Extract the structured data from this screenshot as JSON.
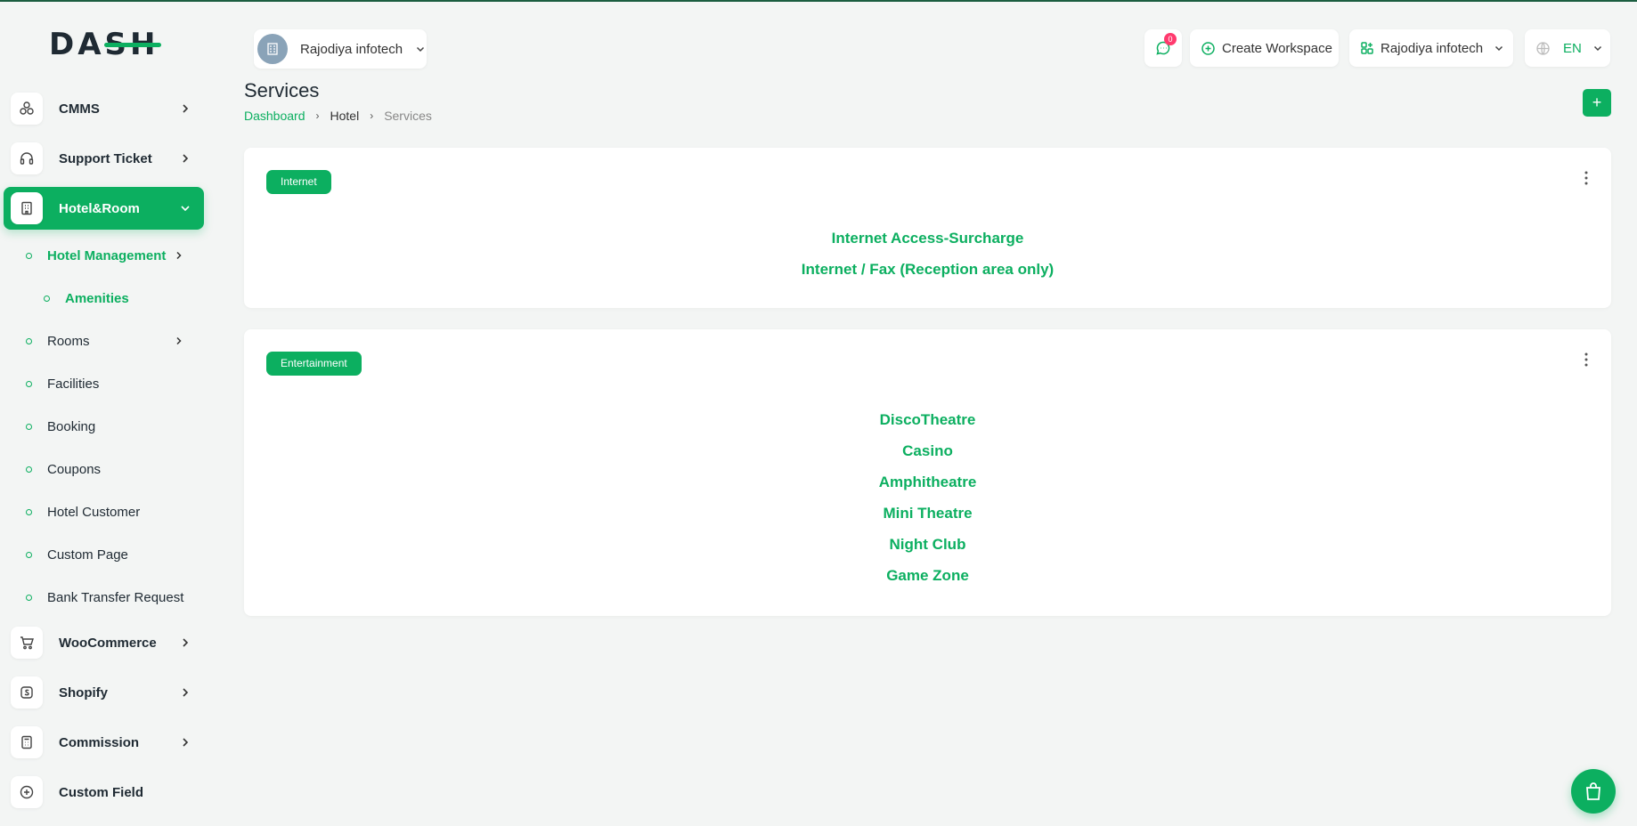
{
  "brand": {
    "logo_text": "DASH"
  },
  "sidebar": {
    "items": [
      {
        "label": "CMMS",
        "icon": "cmms-icon"
      },
      {
        "label": "Support Ticket",
        "icon": "headset-icon"
      },
      {
        "label": "Hotel&Room",
        "icon": "building-icon"
      },
      {
        "label": "WooCommerce",
        "icon": "cart-icon"
      },
      {
        "label": "Shopify",
        "icon": "shopify-icon"
      },
      {
        "label": "Commission",
        "icon": "calculator-icon"
      },
      {
        "label": "Custom Field",
        "icon": "plus-circle-icon"
      }
    ],
    "sub_items": [
      {
        "label": "Hotel Management"
      },
      {
        "label": "Amenities"
      },
      {
        "label": "Rooms"
      },
      {
        "label": "Facilities"
      },
      {
        "label": "Booking"
      },
      {
        "label": "Coupons"
      },
      {
        "label": "Hotel Customer"
      },
      {
        "label": "Custom Page"
      },
      {
        "label": "Bank Transfer Request"
      }
    ]
  },
  "header": {
    "workspace_name": "Rajodiya infotech",
    "notification_count": "0",
    "create_workspace_label": "Create Workspace",
    "user_workspace_label": "Rajodiya infotech",
    "language": "EN"
  },
  "page": {
    "title": "Services",
    "breadcrumb": [
      "Dashboard",
      "Hotel",
      "Services"
    ],
    "add_button": "+"
  },
  "cards": [
    {
      "tag": "Internet",
      "services": [
        "Internet Access-Surcharge",
        "Internet / Fax (Reception area only)"
      ]
    },
    {
      "tag": "Entertainment",
      "services": [
        "DiscoTheatre",
        "Casino",
        "Amphitheatre",
        "Mini Theatre",
        "Night Club",
        "Game Zone"
      ]
    }
  ],
  "colors": {
    "accent": "#0caf60",
    "badge": "#ff3a6e",
    "text": "#1f2a33"
  }
}
